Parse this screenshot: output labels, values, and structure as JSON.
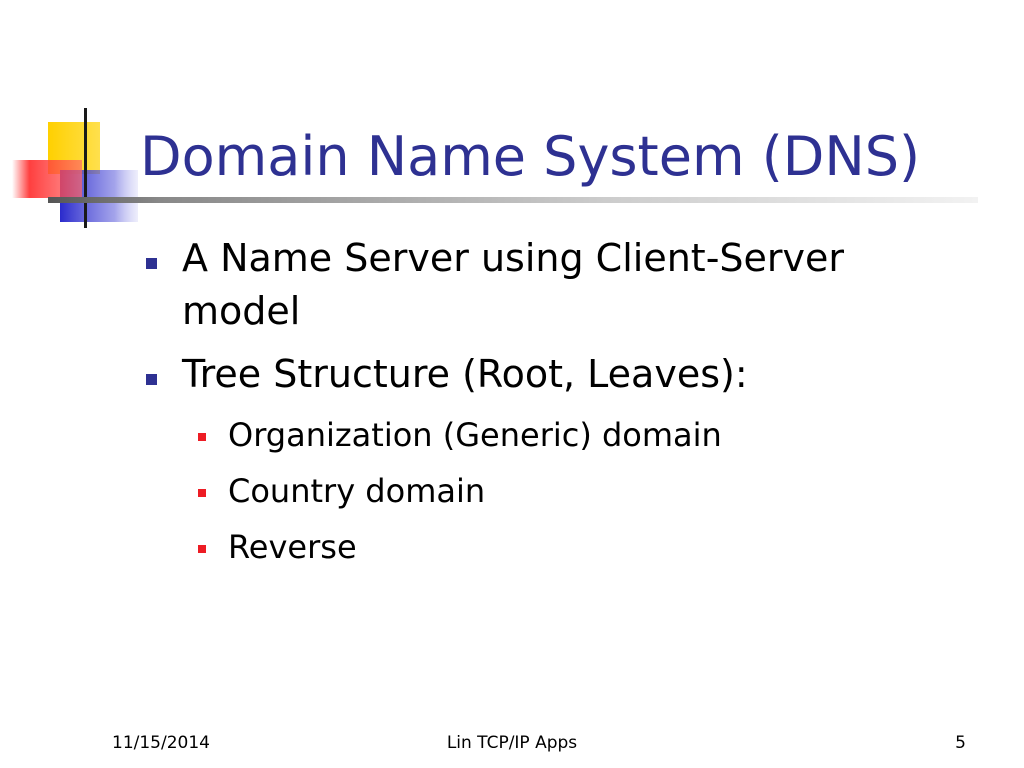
{
  "slide": {
    "title": "Domain Name System (DNS)",
    "bullets": [
      {
        "text": "A Name Server using Client-Server model",
        "subitems": []
      },
      {
        "text": "Tree Structure (Root, Leaves):",
        "subitems": [
          "Organization (Generic) domain",
          "Country domain",
          "Reverse"
        ]
      }
    ],
    "footer": {
      "date": "11/15/2014",
      "center": "Lin TCP/IP Apps",
      "page": "5"
    }
  },
  "colors": {
    "title": "#2e3192",
    "level1_bullet": "#2e3192",
    "level2_bullet": "#ed1c24",
    "logo_yellow": "#ffd200",
    "logo_blue": "#3333cc",
    "logo_red": "#ff3333"
  }
}
